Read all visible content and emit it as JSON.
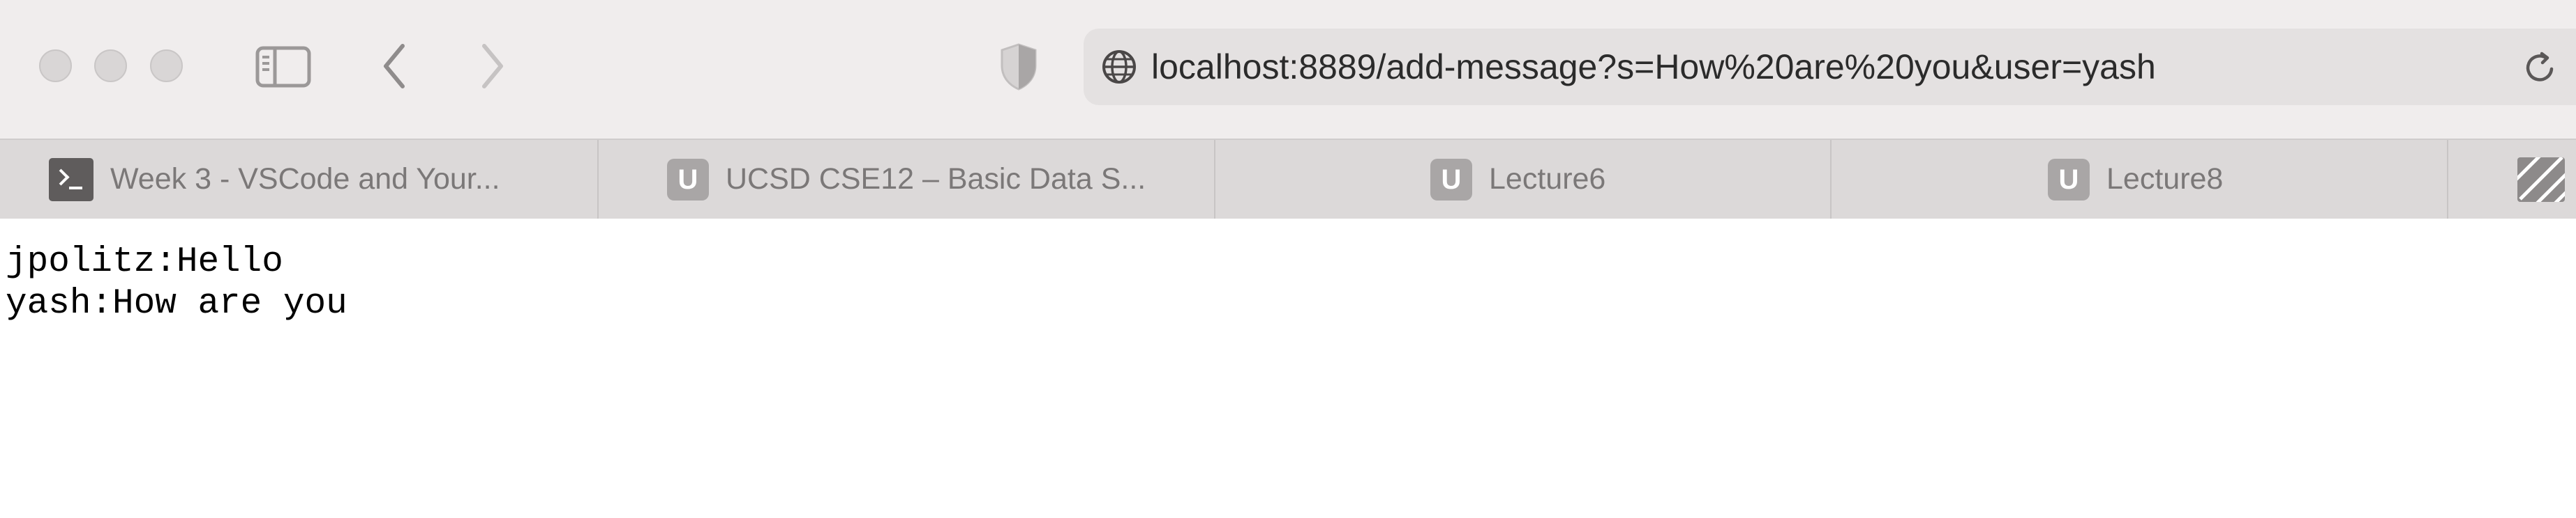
{
  "window": {
    "controls": [
      "close",
      "minimize",
      "maximize"
    ]
  },
  "toolbar": {
    "icons": {
      "sidebar": "sidebar-icon",
      "back": "chevron-left-icon",
      "forward": "chevron-right-icon",
      "privacy": "shield-icon",
      "globe": "globe-icon",
      "reload": "reload-icon"
    },
    "address": "localhost:8889/add-message?s=How%20are%20you&user=yash"
  },
  "tabs": [
    {
      "label": "Week 3 - VSCode and Your...",
      "favicon": "terminal-icon"
    },
    {
      "label": "UCSD CSE12 – Basic Data S...",
      "favicon": "U"
    },
    {
      "label": "Lecture6",
      "favicon": "U"
    },
    {
      "label": "Lecture8",
      "favicon": "U"
    },
    {
      "label": "",
      "favicon": "striped-tab-icon"
    }
  ],
  "content": {
    "lines": [
      "jpolitz:Hello",
      "yash:How are you"
    ]
  },
  "colors": {
    "toolbar_bg": "#f0eded",
    "tabbar_bg": "#dcd9d9",
    "address_bg": "#e4e1e1",
    "icon_gray": "#9b9898",
    "page_bg": "#ffffff"
  }
}
